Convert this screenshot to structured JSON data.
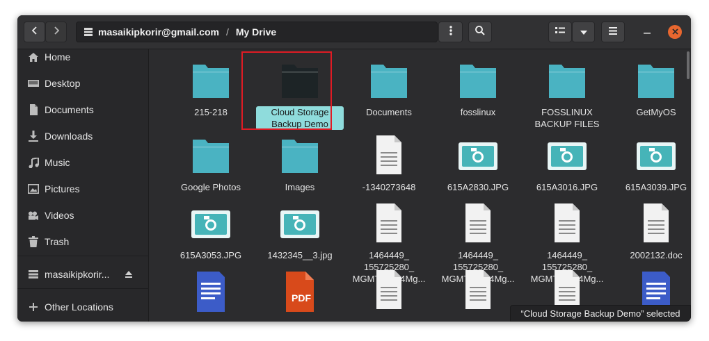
{
  "header": {
    "account": "masaikipkorir@gmail.com",
    "separator": "/",
    "folder": "My Drive"
  },
  "sidebar": {
    "places": [
      {
        "label": "Home",
        "icon": "home-icon"
      },
      {
        "label": "Desktop",
        "icon": "desktop-icon"
      },
      {
        "label": "Documents",
        "icon": "documents-icon"
      },
      {
        "label": "Downloads",
        "icon": "downloads-icon"
      },
      {
        "label": "Music",
        "icon": "music-icon"
      },
      {
        "label": "Pictures",
        "icon": "pictures-icon"
      },
      {
        "label": "Videos",
        "icon": "videos-icon"
      },
      {
        "label": "Trash",
        "icon": "trash-icon"
      }
    ],
    "mount": {
      "label": "masaikipkorir...",
      "icon": "network-drive-icon"
    },
    "other": {
      "label": "Other Locations",
      "icon": "plus-icon"
    }
  },
  "files": [
    {
      "name": "215-218",
      "type": "folder"
    },
    {
      "name": "Cloud Storage Backup Demo",
      "type": "folder-dark",
      "selected": true
    },
    {
      "name": "Documents",
      "type": "folder"
    },
    {
      "name": "fosslinux",
      "type": "folder"
    },
    {
      "name": "FOSSLINUX BACKUP FILES",
      "type": "folder"
    },
    {
      "name": "GetMyOS",
      "type": "folder"
    },
    {
      "name": "Google Photos",
      "type": "folder"
    },
    {
      "name": "Images",
      "type": "folder"
    },
    {
      "name": "-1340273648",
      "type": "text"
    },
    {
      "name": "615A2830.JPG",
      "type": "image"
    },
    {
      "name": "615A3016.JPG",
      "type": "image"
    },
    {
      "name": "615A3039.JPG",
      "type": "image"
    },
    {
      "name": "615A3053.JPG",
      "type": "image"
    },
    {
      "name": "1432345__3.jpg",
      "type": "image"
    },
    {
      "name": "1464449_ 155725280_ MGMT20144Mg...",
      "type": "text"
    },
    {
      "name": "1464449_ 155725280_ MGMT20144Mg...",
      "type": "text"
    },
    {
      "name": "1464449_ 155725280_ MGMT20144Mg...",
      "type": "text"
    },
    {
      "name": "2002132.doc",
      "type": "text"
    },
    {
      "name": "",
      "type": "doc-blue"
    },
    {
      "name": "",
      "type": "pdf",
      "badge": "PDF"
    },
    {
      "name": "",
      "type": "text"
    },
    {
      "name": "",
      "type": "text"
    },
    {
      "name": "",
      "type": "text"
    },
    {
      "name": "",
      "type": "doc-blue"
    }
  ],
  "status": "“Cloud Storage Backup Demo” selected",
  "colors": {
    "folder": "#4ab3c2",
    "folder_dark": "#1d2427",
    "selection": "#8fdcdc",
    "close": "#e8672f",
    "highlight": "#e01b24"
  }
}
